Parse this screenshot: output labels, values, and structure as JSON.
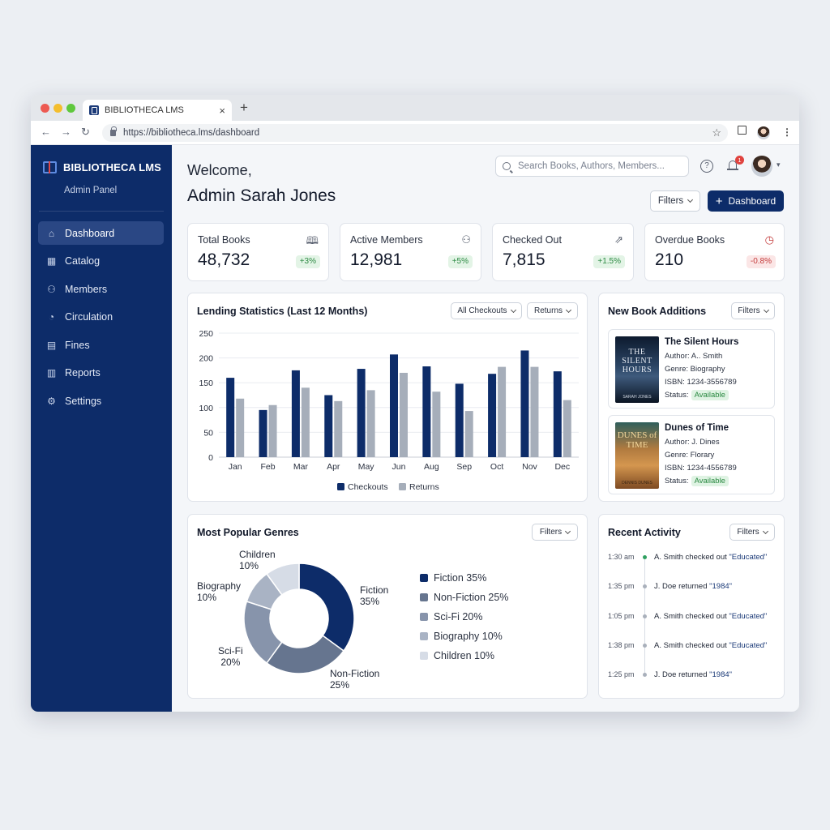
{
  "browser": {
    "tab_title": "BIBLIOTHECA LMS",
    "close_glyph": "×",
    "new_tab_glyph": "+",
    "url": "https://bibliotheca.lms/dashboard",
    "traffic_colors": [
      "#ed5a52",
      "#f4be2e",
      "#5fc83d"
    ]
  },
  "sidebar": {
    "brand": "BIBLIOTHECA LMS",
    "subtitle": "Admin Panel",
    "items": [
      {
        "label": "Dashboard",
        "icon": "home-icon",
        "active": true
      },
      {
        "label": "Catalog",
        "icon": "grid-icon"
      },
      {
        "label": "Members",
        "icon": "users-icon"
      },
      {
        "label": "Circulation",
        "icon": "circulation-icon"
      },
      {
        "label": "Fines",
        "icon": "receipt-icon"
      },
      {
        "label": "Reports",
        "icon": "report-icon"
      },
      {
        "label": "Settings",
        "icon": "gear-icon"
      }
    ]
  },
  "header": {
    "welcome": "Welcome,",
    "admin_name": "Admin Sarah Jones",
    "search_placeholder": "Search Books, Authors, Members...",
    "notifications": "1",
    "filters_label": "Filters",
    "dashboard_button": "Dashboard"
  },
  "stats": [
    {
      "label": "Total Books",
      "value": "48,732",
      "change": "+3%",
      "trend": "up",
      "icon": "book-open-icon"
    },
    {
      "label": "Active Members",
      "value": "12,981",
      "change": "+5%",
      "trend": "up",
      "icon": "users-icon"
    },
    {
      "label": "Checked Out",
      "value": "7,815",
      "change": "+1.5%",
      "trend": "up",
      "icon": "checkout-icon"
    },
    {
      "label": "Overdue Books",
      "value": "210",
      "change": "-0.8%",
      "trend": "down",
      "icon": "clock-alert-icon"
    }
  ],
  "lending": {
    "title": "Lending Statistics (Last 12 Months)",
    "filter1": "All Checkouts",
    "filter2": "Returns"
  },
  "chart_data": [
    {
      "type": "bar",
      "title": "Lending Statistics (Last 12 Months)",
      "categories": [
        "Jan",
        "Feb",
        "Mar",
        "Apr",
        "May",
        "Jun",
        "Aug",
        "Sep",
        "Oct",
        "Nov",
        "Dec"
      ],
      "series": [
        {
          "name": "Checkouts",
          "color": "#0d2c69",
          "values": [
            160,
            95,
            175,
            125,
            178,
            207,
            183,
            148,
            168,
            215,
            173
          ]
        },
        {
          "name": "Returns",
          "color": "#a6aeba",
          "values": [
            118,
            105,
            140,
            113,
            135,
            170,
            132,
            93,
            182,
            182,
            115
          ]
        }
      ],
      "ylim": [
        0,
        250
      ],
      "yticks": [
        0,
        50,
        100,
        150,
        200,
        250
      ],
      "grid": true,
      "legend": "bottom"
    },
    {
      "type": "pie",
      "title": "Most Popular Genres",
      "slices": [
        {
          "label": "Fiction",
          "value": 35,
          "pct": "35%",
          "color": "#0d2c69"
        },
        {
          "label": "Non-Fiction",
          "value": 25,
          "pct": "25%",
          "color": "#66758f"
        },
        {
          "label": "Sci-Fi",
          "value": 20,
          "pct": "20%",
          "color": "#8794ab"
        },
        {
          "label": "Biography",
          "value": 10,
          "pct": "10%",
          "color": "#a9b3c4"
        },
        {
          "label": "Children",
          "value": 10,
          "pct": "10%",
          "color": "#d6dce6"
        }
      ],
      "legend": "right"
    }
  ],
  "genres": {
    "title": "Most Popular Genres",
    "filters_label": "Filters",
    "legend": [
      "Fiction 35%",
      "Non-Fiction 25%",
      "Sci-Fi 20%",
      "Biography 10%",
      "Children 10%"
    ],
    "labels": [
      {
        "name": "Children",
        "pct": "10%"
      },
      {
        "name": "Biography",
        "pct": "10%"
      },
      {
        "name": "Fiction",
        "pct": "35%"
      },
      {
        "name": "Sci-Fi",
        "pct": "20%"
      },
      {
        "name": "Non-Fiction",
        "pct": "25%"
      }
    ]
  },
  "new_books": {
    "title": "New Book Additions",
    "filters_label": "Filters",
    "items": [
      {
        "title": "The Silent Hours",
        "author": "Author: A.. Smith",
        "genre": "Genre: Biography",
        "isbn": "ISBN: 1234-3556789",
        "status_label": "Status:",
        "status": "Available",
        "cover_title": "THE SILENT HOURS",
        "cover_author": "SARAH JONES"
      },
      {
        "title": "Dunes of Time",
        "author": "Author: J. Dines",
        "genre": "Genre: Florary",
        "isbn": "ISBN: 1234-4556789",
        "status_label": "Status:",
        "status": "Available",
        "cover_title": "DUNES of TIME",
        "cover_author": "DENNIS DUNES"
      }
    ]
  },
  "activity": {
    "title": "Recent Activity",
    "filters_label": "Filters",
    "items": [
      {
        "time": "1:30 am",
        "text": "A. Smith checked out",
        "book": "\"Educated\"",
        "highlight": true
      },
      {
        "time": "1:35 pm",
        "text": "J. Doe returned",
        "book": "\"1984\""
      },
      {
        "time": "1:05 pm",
        "text": "A. Smith checked out",
        "book": "\"Educated\""
      },
      {
        "time": "1:38 pm",
        "text": "A. Smith checked out",
        "book": "\"Educated\""
      },
      {
        "time": "1:25 pm",
        "text": "J. Doe returned",
        "book": "\"1984\""
      }
    ]
  }
}
